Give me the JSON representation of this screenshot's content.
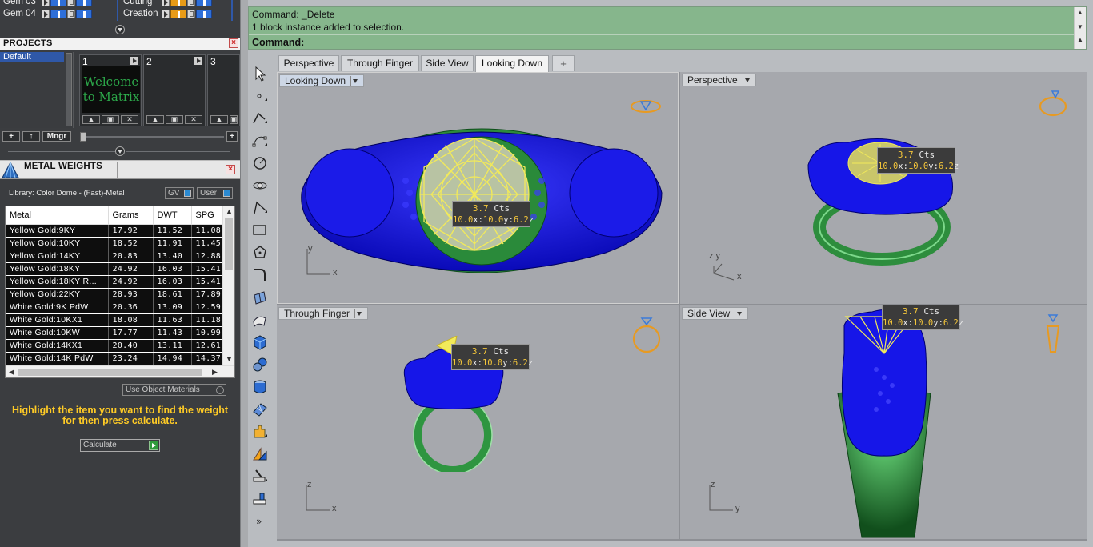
{
  "layers": [
    {
      "name": "Gem 03",
      "color": "#2e6fd9"
    },
    {
      "name": "Gem 04",
      "color": "#2e6fd9"
    }
  ],
  "layers_right": [
    {
      "name": "Cutting",
      "color": "#e89b17"
    },
    {
      "name": "Creation",
      "color": "#e89b17"
    }
  ],
  "projects": {
    "header": "PROJECTS",
    "list": [
      "Default"
    ],
    "thumbnails": [
      {
        "num": "1",
        "caption": "Welcome to Matrix"
      },
      {
        "num": "2",
        "caption": ""
      },
      {
        "num": "3",
        "caption": ""
      }
    ],
    "mngr_label": "Mngr"
  },
  "metal_weights": {
    "title": "METAL WEIGHTS",
    "library": "Library: Color Dome - (Fast)-Metal",
    "toggle_gv": "GV",
    "toggle_user": "User",
    "columns": [
      "Metal",
      "Grams",
      "DWT",
      "SPG"
    ],
    "rows": [
      [
        "Yellow Gold:9KY",
        "17.92",
        "11.52",
        "11.08"
      ],
      [
        "Yellow Gold:10KY",
        "18.52",
        "11.91",
        "11.45"
      ],
      [
        "Yellow Gold:14KY",
        "20.83",
        "13.40",
        "12.88"
      ],
      [
        "Yellow Gold:18KY",
        "24.92",
        "16.03",
        "15.41"
      ],
      [
        "Yellow Gold:18KY R...",
        "24.92",
        "16.03",
        "15.41"
      ],
      [
        "Yellow Gold:22KY",
        "28.93",
        "18.61",
        "17.89"
      ],
      [
        "White Gold:9K PdW",
        "20.36",
        "13.09",
        "12.59"
      ],
      [
        "White Gold:10KX1",
        "18.08",
        "11.63",
        "11.18"
      ],
      [
        "White Gold:10KW",
        "17.77",
        "11.43",
        "10.99"
      ],
      [
        "White Gold:14KX1",
        "20.40",
        "13.11",
        "12.61"
      ],
      [
        "White Gold:14K PdW",
        "23.24",
        "14.94",
        "14.37"
      ]
    ],
    "use_object_materials": "Use Object Materials",
    "hint": "Highlight the item you want to find the weight for then press calculate.",
    "calculate": "Calculate"
  },
  "command": {
    "line1": "Command: _Delete",
    "line2": "1 block instance added to selection.",
    "prompt": "Command:"
  },
  "tabs": [
    "Perspective",
    "Through Finger",
    "Side View",
    "Looking Down",
    "+"
  ],
  "active_tab": "Looking Down",
  "viewports": {
    "looking_down": {
      "label": "Looking Down",
      "axis_v": "y",
      "axis_h": "x"
    },
    "perspective": {
      "label": "Perspective",
      "axis_v": "z y",
      "axis_h": "x"
    },
    "through_finger": {
      "label": "Through Finger",
      "axis_v": "z",
      "axis_h": "x"
    },
    "side_view": {
      "label": "Side View",
      "axis_v": "z",
      "axis_h": "y"
    }
  },
  "gem_info": {
    "carats": "3.7",
    "cts_unit": "Cts",
    "x": "10.0",
    "y": "10.0",
    "z": "6.2"
  },
  "colors": {
    "metal_blue": "#1414e6",
    "shank_green": "#3fa650",
    "gem_yellow": "#f2ea5a",
    "command_bg": "#86b68c",
    "hint": "#ffcb25"
  }
}
